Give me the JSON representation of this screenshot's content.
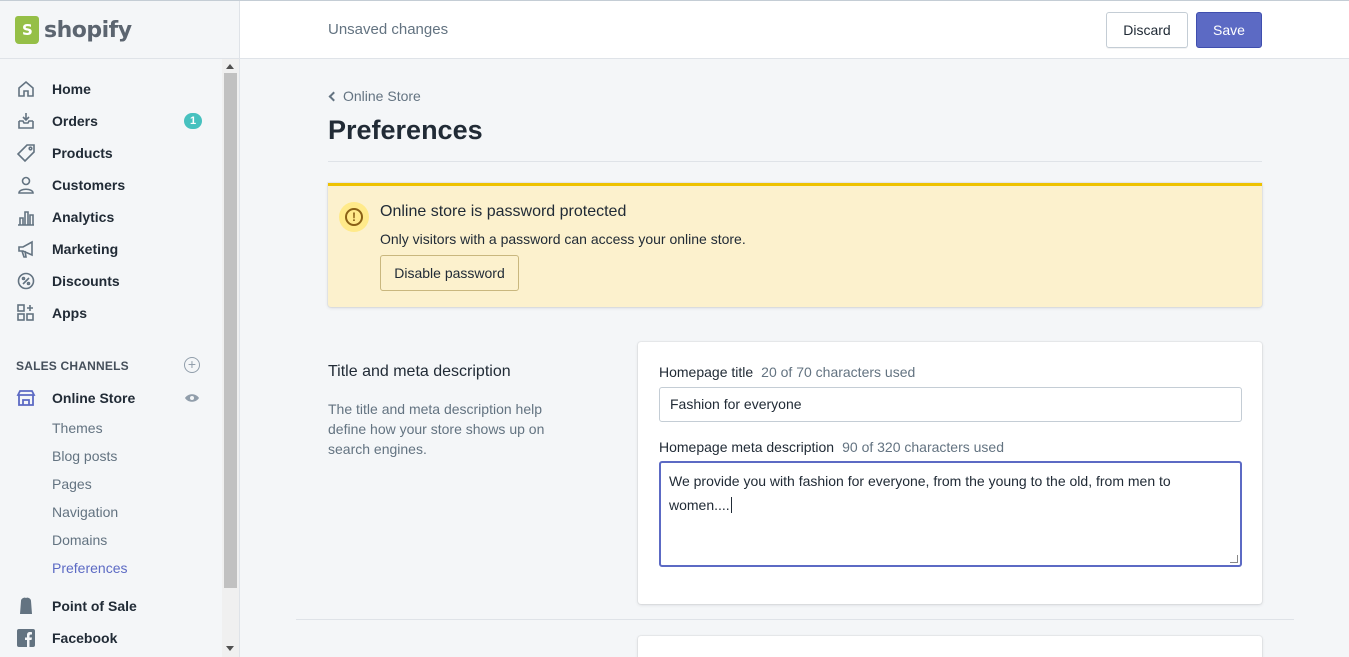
{
  "app": {
    "brand": "shopify"
  },
  "topbar": {
    "status": "Unsaved changes",
    "discard_label": "Discard",
    "save_label": "Save"
  },
  "sidebar": {
    "items": [
      {
        "label": "Home",
        "icon": "home-icon"
      },
      {
        "label": "Orders",
        "icon": "orders-icon",
        "badge": "1"
      },
      {
        "label": "Products",
        "icon": "tag-icon"
      },
      {
        "label": "Customers",
        "icon": "person-icon"
      },
      {
        "label": "Analytics",
        "icon": "bar-chart-icon"
      },
      {
        "label": "Marketing",
        "icon": "megaphone-icon"
      },
      {
        "label": "Discounts",
        "icon": "discount-icon"
      },
      {
        "label": "Apps",
        "icon": "apps-icon"
      }
    ],
    "sales_channels_header": "SALES CHANNELS",
    "online_store": {
      "label": "Online Store",
      "sub_items": [
        "Themes",
        "Blog posts",
        "Pages",
        "Navigation",
        "Domains",
        "Preferences"
      ],
      "active_sub": "Preferences"
    },
    "more_channels": [
      {
        "label": "Point of Sale",
        "icon": "pos-icon"
      },
      {
        "label": "Facebook",
        "icon": "facebook-icon"
      }
    ]
  },
  "page": {
    "breadcrumb": "Online Store",
    "title": "Preferences"
  },
  "banner": {
    "title": "Online store is password protected",
    "text": "Only visitors with a password can access your online store.",
    "button_label": "Disable password",
    "color": "#fcf1cd"
  },
  "seo_section": {
    "title": "Title and meta description",
    "description": "The title and meta description help define how your store shows up on search engines.",
    "homepage_title_label": "Homepage title",
    "homepage_title_help": "20 of 70 characters used",
    "homepage_title_value": "Fashion for everyone",
    "meta_label": "Homepage meta description",
    "meta_help": "90 of 320 characters used",
    "meta_value": "We provide you with fashion for everyone, from the young to the old, from men to women...."
  },
  "colors": {
    "accent": "#5c6ac4",
    "badge": "#47c1bf",
    "warning_border": "#eec200"
  }
}
